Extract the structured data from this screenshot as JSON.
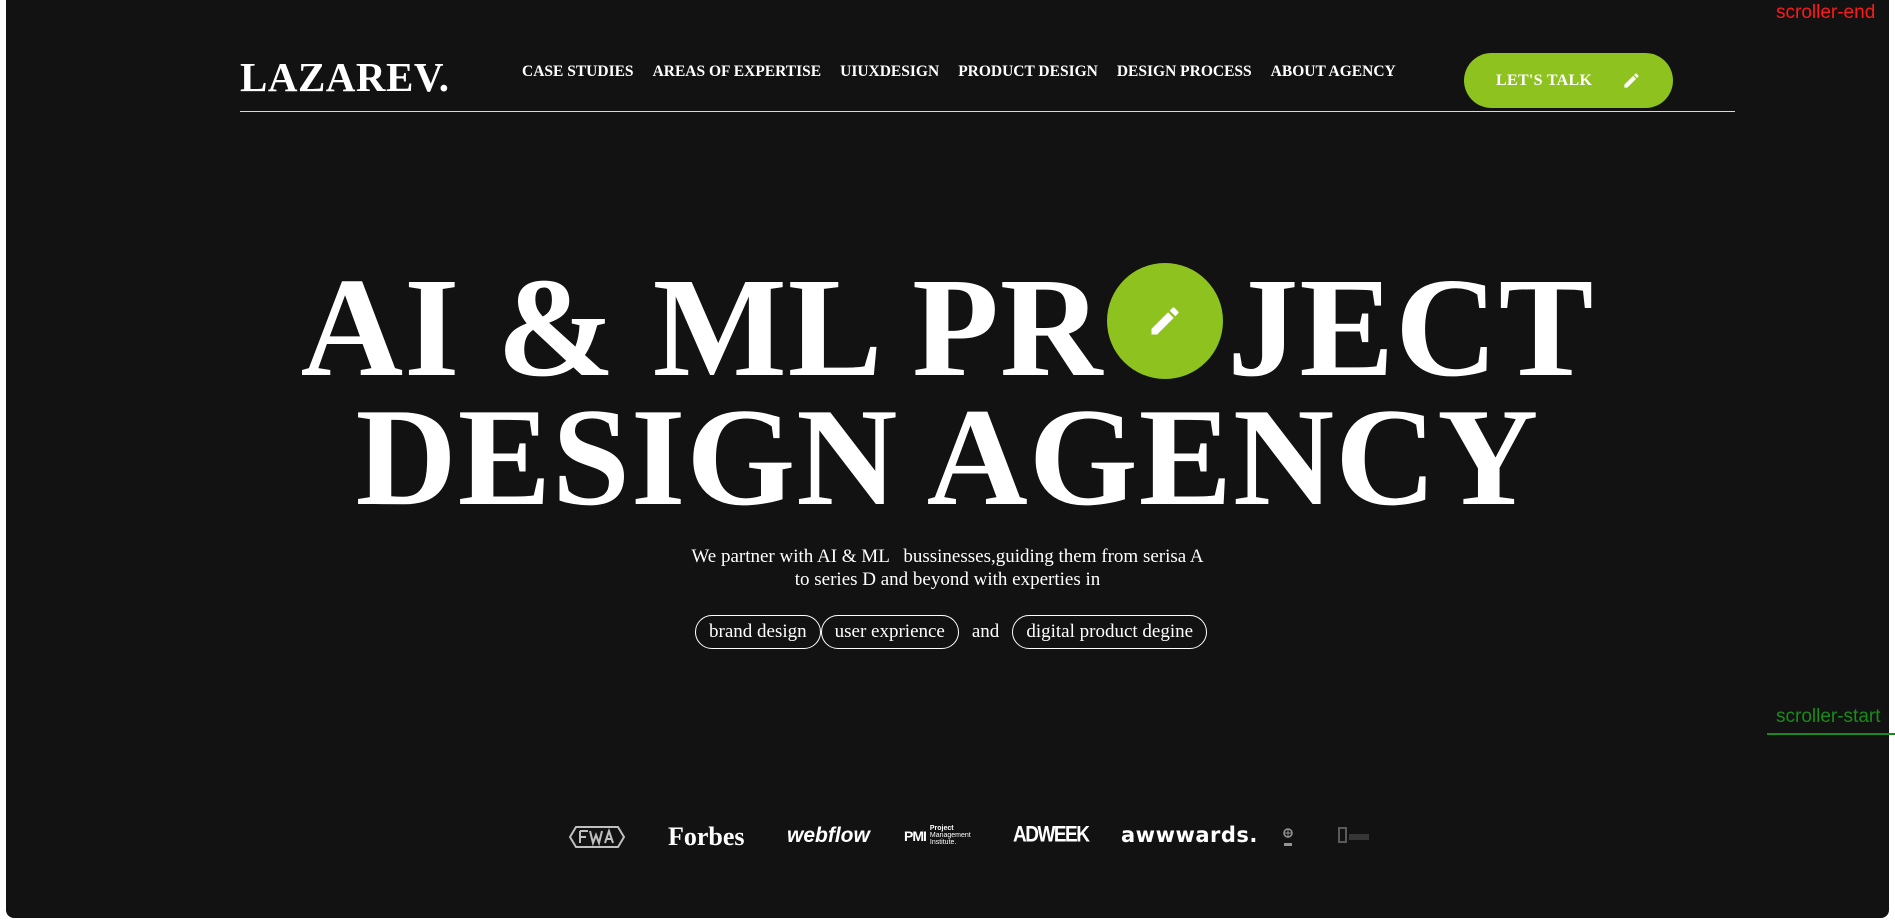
{
  "header": {
    "logo": "LAZAREV.",
    "nav": [
      {
        "label": "CASE STUDIES"
      },
      {
        "label": "AREAS OF EXPERTISE"
      },
      {
        "label": "UIUXDESIGN"
      },
      {
        "label": "PRODUCT DESIGN"
      },
      {
        "label": "DESIGN PROCESS"
      },
      {
        "label": "ABOUT AGENCY"
      }
    ],
    "cta_label": "LET'S TALK",
    "cta_icon": "pencil-icon"
  },
  "hero": {
    "line1_before": "AI & ML PR",
    "line1_after": "JECT",
    "o_icon": "pencil-icon",
    "line2": "DESIGN AGENCY",
    "subtitle_line1": "We partner with AI & ML   bussinesses,guiding them from serisa A",
    "subtitle_line2": "to series D and beyond with experties in",
    "pills": [
      "brand design",
      "user exprience",
      "digital product degine"
    ],
    "pill_separator": "and"
  },
  "logos": {
    "forbes": "Forbes",
    "webflow": "webflow",
    "pmi_mark": "PMI",
    "pmi_lines": [
      "Project",
      "Management",
      "Institute."
    ],
    "adweek": "ADWEEK",
    "awwwards": "awwwards."
  },
  "markers": {
    "end": "scroller-end",
    "start": "scroller-start"
  },
  "colors": {
    "background": "#121212",
    "accent": "#8dc21f",
    "text": "#ffffff",
    "marker_end": "#ff1a1a",
    "marker_start": "#1a8a1a"
  }
}
